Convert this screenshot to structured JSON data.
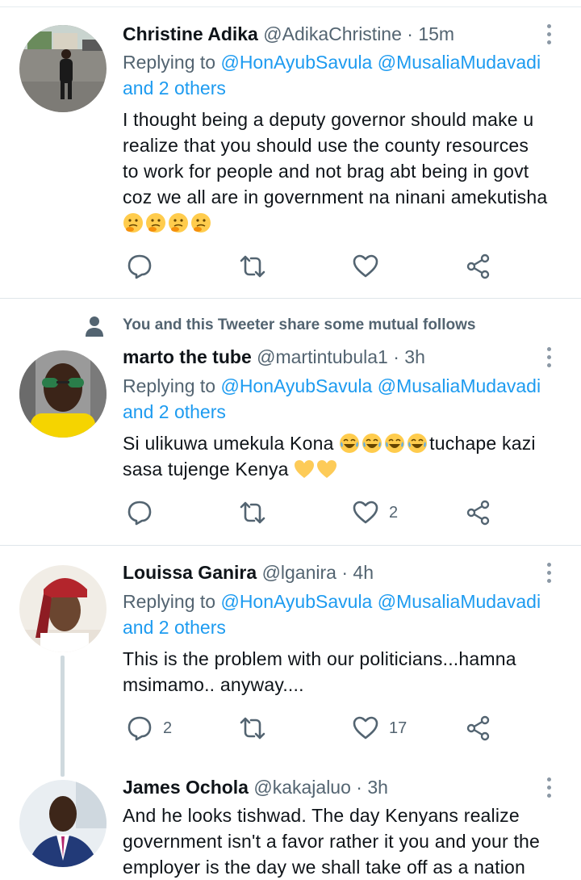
{
  "tweets": [
    {
      "name": "Christine Adika",
      "handle": "@AdikaChristine",
      "dot": "·",
      "time": "15m",
      "replying_prefix": "Replying to ",
      "mention1": "@HonAyubSavula",
      "mention2": "@MusaliaMudavadi",
      "and_others": "and 2 others",
      "lines": [
        "I thought being a deputy governor should make u",
        "realize that you should use the county resources",
        "to work for people and not brag abt being in govt",
        "coz we all are in government na ninani amekutisha"
      ],
      "emoji_line": [
        "thinking-face",
        "thinking-face",
        "thinking-face",
        "thinking-face"
      ],
      "reply_count": "",
      "like_count": ""
    },
    {
      "social_context": "You and this Tweeter share some mutual follows",
      "name": "marto the tube",
      "handle": "@martintubula1",
      "dot": "·",
      "time": "3h",
      "replying_prefix": "Replying to ",
      "mention1": "@HonAyubSavula",
      "mention2": "@MusaliaMudavadi",
      "and_others": "and 2 others",
      "line1_a": "Si ulikuwa umekula Kona ",
      "line1_emojis": [
        "joy-face",
        "joy-face",
        "joy-face",
        "joy-face"
      ],
      "line1_b": "tuchape kazi",
      "line2_a": "sasa tujenge Kenya ",
      "line2_emojis": [
        "yellow-heart",
        "yellow-heart"
      ],
      "reply_count": "",
      "like_count": "2"
    },
    {
      "name": "Louissa Ganira",
      "handle": "@lganira",
      "dot": "·",
      "time": "4h",
      "replying_prefix": "Replying to ",
      "mention1": "@HonAyubSavula",
      "mention2": "@MusaliaMudavadi",
      "and_others": "and 2 others",
      "lines": [
        "This is the problem with our politicians...hamna",
        "msimamo.. anyway...."
      ],
      "reply_count": "2",
      "like_count": "17"
    },
    {
      "name": "James Ochola",
      "handle": "@kakajaluo",
      "dot": "·",
      "time": "3h",
      "lines": [
        "And he looks tishwad. The day Kenyans realize",
        "government isn't a favor rather it you and your the",
        "employer is the day we shall take off as a nation"
      ]
    }
  ],
  "colors": {
    "link": "#1d9bf0",
    "secondary": "#536471",
    "divider": "#dfe5ea"
  }
}
